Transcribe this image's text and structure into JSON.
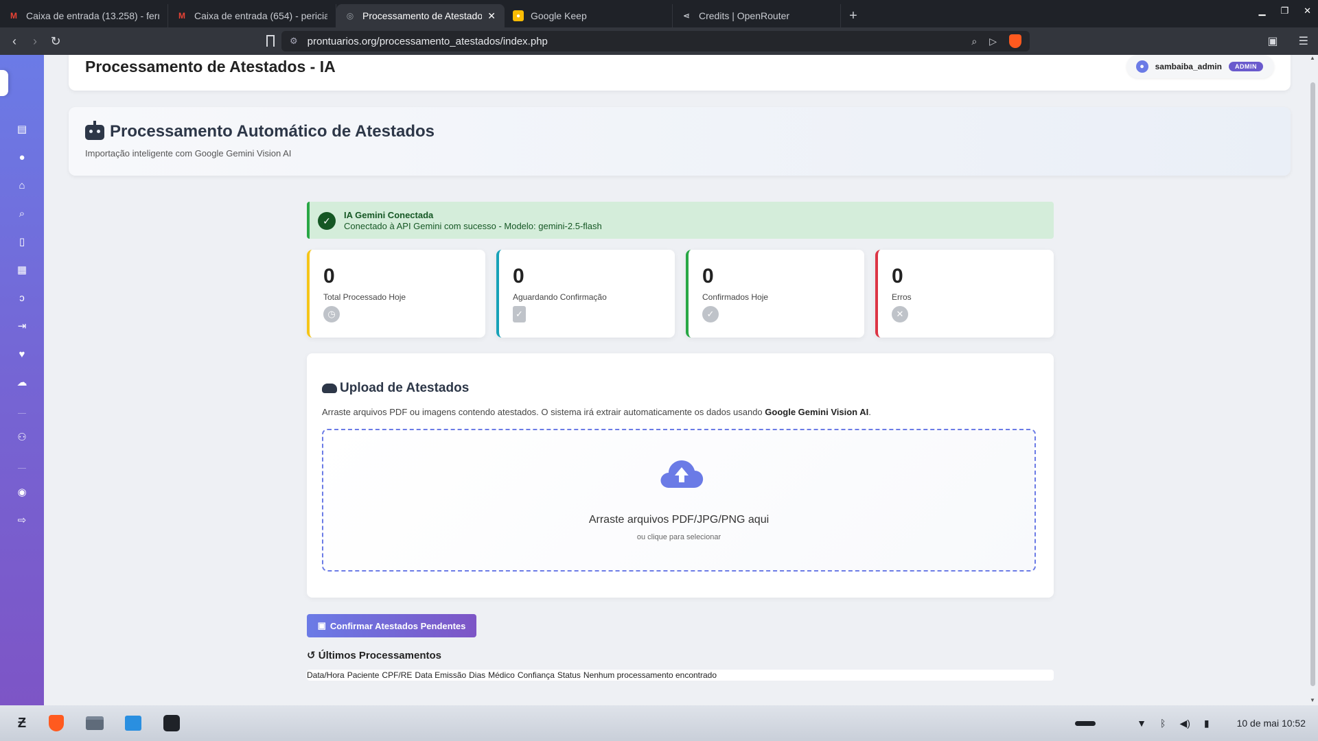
{
  "browser": {
    "tabs": [
      {
        "title": "Caixa de entrada (13.258) - fern",
        "icon": "gmail-icon"
      },
      {
        "title": "Caixa de entrada (654) - pericia",
        "icon": "gmail-icon"
      },
      {
        "title": "Processamento de Atestados",
        "icon": "site-icon",
        "active": true
      },
      {
        "title": "Google Keep",
        "icon": "keep-icon"
      },
      {
        "title": "Credits | OpenRouter",
        "icon": "openrouter-icon"
      }
    ],
    "url": "prontuarios.org/processamento_atestados/index.php"
  },
  "header": {
    "title": "Processamento de Atestados - IA",
    "user_name": "sambaiba_admin",
    "role_badge": "ADMIN"
  },
  "hero": {
    "title": "Processamento Automático de Atestados",
    "subtitle": "Importação inteligente com Google Gemini Vision AI"
  },
  "alert": {
    "title": "IA Gemini Conectada",
    "message": "Conectado à API Gemini com sucesso - Modelo: gemini-2.5-flash"
  },
  "stats": [
    {
      "value": "0",
      "label": "Total Processado Hoje",
      "accent": "#f5c518",
      "icon": "clock-icon"
    },
    {
      "value": "0",
      "label": "Aguardando Confirmação",
      "accent": "#17a2b8",
      "icon": "clipboard-check-icon"
    },
    {
      "value": "0",
      "label": "Confirmados Hoje",
      "accent": "#28a745",
      "icon": "check-circle-icon"
    },
    {
      "value": "0",
      "label": "Erros",
      "accent": "#dc3545",
      "icon": "x-circle-icon"
    }
  ],
  "upload": {
    "title": "Upload de Atestados",
    "description_prefix": "Arraste arquivos PDF ou imagens contendo atestados. O sistema irá extrair automaticamente os dados usando ",
    "description_strong": "Google Gemini Vision AI",
    "description_suffix": ".",
    "dropzone_main": "Arraste arquivos PDF/JPG/PNG aqui",
    "dropzone_sub": "ou clique para selecionar"
  },
  "actions": {
    "confirm_label": "Confirmar Atestados Pendentes"
  },
  "recent": {
    "title": "Últimos Processamentos",
    "columns": [
      "Data/Hora",
      "Paciente",
      "CPF/RE",
      "Data Emissão",
      "Dias",
      "Médico",
      "Confiança",
      "Status"
    ],
    "empty_message": "Nenhum processamento encontrado"
  },
  "taskbar": {
    "clock": "10 de mai  10:52"
  },
  "colors": {
    "sidebar_start": "#6b7be6",
    "sidebar_end": "#7d55c6",
    "success": "#28a745",
    "danger": "#dc3545",
    "warning": "#f5c518",
    "info": "#17a2b8"
  }
}
